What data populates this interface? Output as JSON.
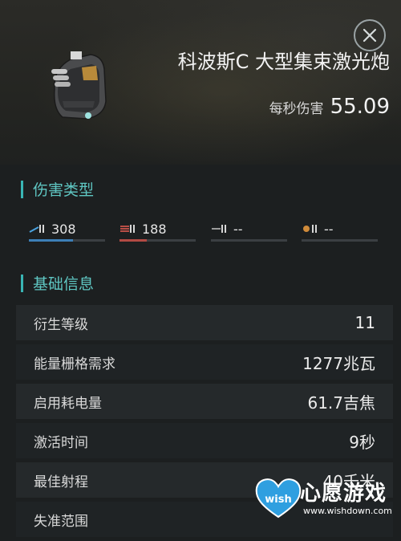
{
  "item": {
    "name": "科波斯C 大型集束激光炮",
    "dps_label": "每秒伤害",
    "dps_value": "55.09"
  },
  "damage_section": {
    "title": "伤害类型",
    "types": [
      {
        "icon": "em-damage-icon",
        "value": "308",
        "fill": 0.58,
        "color": "#3d7fb7"
      },
      {
        "icon": "thermal-damage-icon",
        "value": "188",
        "fill": 0.36,
        "color": "#b24a43"
      },
      {
        "icon": "kinetic-damage-icon",
        "value": "--",
        "fill": 0,
        "color": "#8e8e8e"
      },
      {
        "icon": "explosive-damage-icon",
        "value": "--",
        "fill": 0,
        "color": "#c98a3a"
      }
    ]
  },
  "basic_section": {
    "title": "基础信息",
    "rows": [
      {
        "label": "衍生等级",
        "value": "11"
      },
      {
        "label": "能量栅格需求",
        "value": "1277兆瓦"
      },
      {
        "label": "启用耗电量",
        "value": "61.7吉焦"
      },
      {
        "label": "激活时间",
        "value": "9秒"
      },
      {
        "label": "最佳射程",
        "value": "40千米"
      },
      {
        "label": "失准范围",
        "value": ""
      }
    ]
  },
  "watermark": {
    "title": "心愿游戏",
    "url": "www.wishdown.com",
    "badge": "wish"
  },
  "colors": {
    "accent": "#39b5b4",
    "em": "#3d7fb7",
    "thermal": "#b24a43"
  }
}
